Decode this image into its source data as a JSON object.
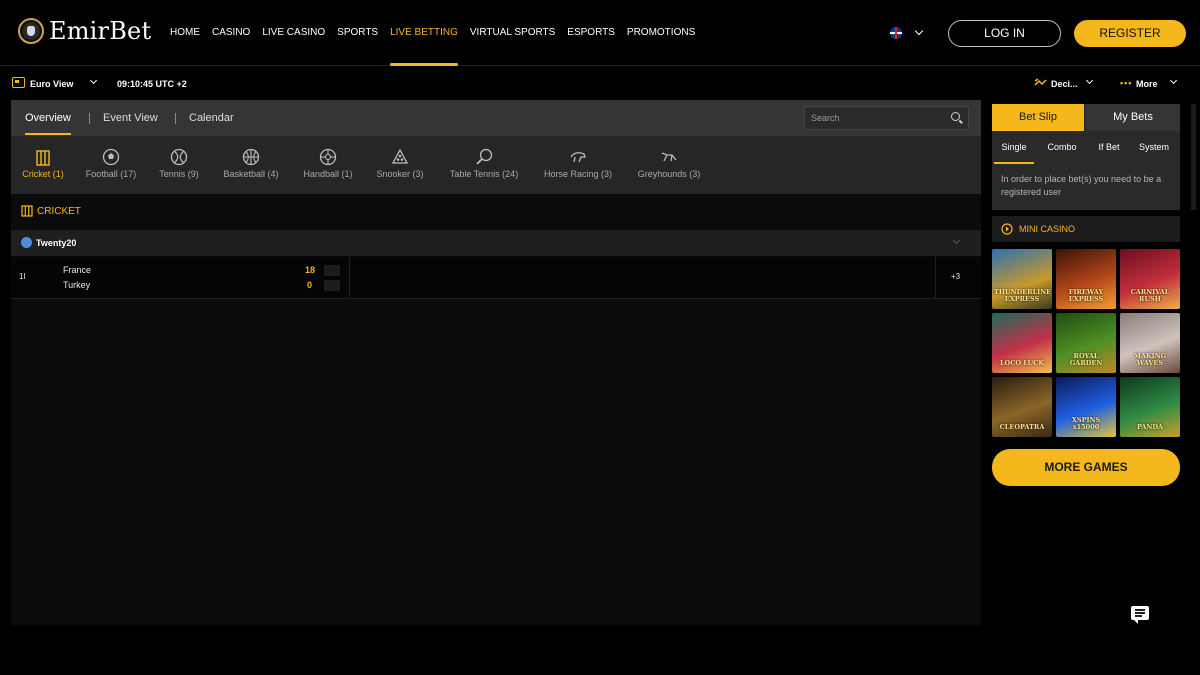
{
  "brand": {
    "name": "EmirBet"
  },
  "nav": {
    "items": [
      "HOME",
      "CASINO",
      "LIVE CASINO",
      "SPORTS",
      "LIVE BETTING",
      "VIRTUAL SPORTS",
      "ESPORTS",
      "PROMOTIONS"
    ],
    "active": "LIVE BETTING"
  },
  "auth": {
    "login": "LOG IN",
    "register": "REGISTER"
  },
  "subbar": {
    "view": "Euro View",
    "time": "09:10:45 UTC +2",
    "odds_format": "Deci...",
    "more": "More"
  },
  "tabs": [
    "Overview",
    "Event View",
    "Calendar"
  ],
  "search": {
    "placeholder": "Search"
  },
  "sports": [
    {
      "label": "Cricket (1)",
      "icon": "cricket-icon"
    },
    {
      "label": "Football (17)",
      "icon": "football-icon"
    },
    {
      "label": "Tennis (9)",
      "icon": "tennis-icon"
    },
    {
      "label": "Basketball (4)",
      "icon": "basketball-icon"
    },
    {
      "label": "Handball (1)",
      "icon": "handball-icon"
    },
    {
      "label": "Snooker (3)",
      "icon": "snooker-icon"
    },
    {
      "label": "Table Tennis (24)",
      "icon": "table-tennis-icon"
    },
    {
      "label": "Horse Racing (3)",
      "icon": "horse-racing-icon"
    },
    {
      "label": "Greyhounds (3)",
      "icon": "greyhound-icon"
    }
  ],
  "section": {
    "title": "CRICKET"
  },
  "league": {
    "name": "Twenty20"
  },
  "match": {
    "period": "1I",
    "home": "France",
    "away": "Turkey",
    "home_score": "18",
    "away_score": "0",
    "more_markets": "+3"
  },
  "betslip": {
    "tabs": [
      "Bet Slip",
      "My Bets"
    ],
    "types": [
      "Single",
      "Combo",
      "If Bet",
      "System"
    ],
    "message": "In order to place bet(s) you need to be a registered user"
  },
  "mini_casino": {
    "title": "MINI CASINO",
    "games": [
      {
        "name": "THUNDERLINE EXPRESS"
      },
      {
        "name": "FIREWAY EXPRESS"
      },
      {
        "name": "CARNIVAL RUSH"
      },
      {
        "name": "LOCO LUCK"
      },
      {
        "name": "ROYAL GARDEN"
      },
      {
        "name": "MAKING WAVES"
      },
      {
        "name": "CLEOPATRA"
      },
      {
        "name": "XSPINS x15000"
      },
      {
        "name": "PANDA"
      }
    ],
    "more_games": "MORE GAMES"
  },
  "colors": {
    "accent": "#f5b81c",
    "bg": "#000000",
    "panel": "#353535"
  }
}
